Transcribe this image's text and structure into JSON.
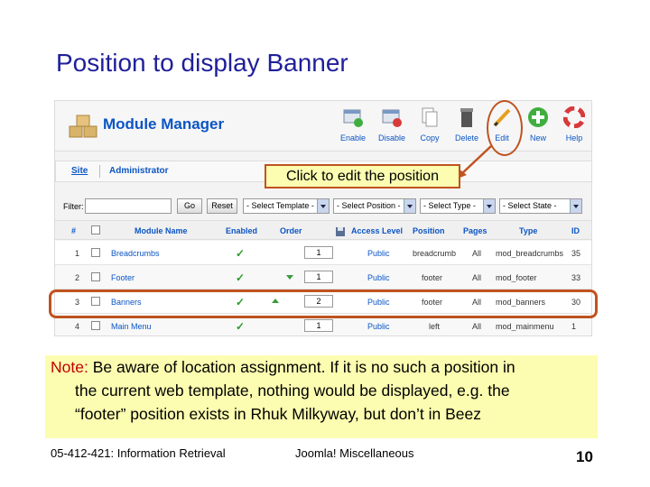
{
  "slide": {
    "title": "Position to display Banner",
    "callout": "Click to edit the position",
    "note_label": "Note:",
    "note_line1": "Be aware of location assignment. If it is no such a position in",
    "note_line2": "the current web template, nothing would be displayed, e.g. the",
    "note_line3": "“footer” position exists in Rhuk Milkyway, but don’t in Beez",
    "footer_left": "05-412-421: Information Retrieval",
    "footer_center": "Joomla! Miscellaneous",
    "page_number": "10"
  },
  "app": {
    "title": "Module Manager",
    "toolbar": {
      "enable": "Enable",
      "disable": "Disable",
      "copy": "Copy",
      "delete": "Delete",
      "edit": "Edit",
      "new": "New",
      "help": "Help"
    },
    "tabs": {
      "site": "Site",
      "administrator": "Administrator"
    },
    "filter": {
      "label": "Filter:",
      "go": "Go",
      "reset": "Reset",
      "template": "- Select Template -",
      "position": "- Select Position -",
      "type": "- Select Type -",
      "state": "- Select State -"
    },
    "columns": {
      "num": "#",
      "name": "Module Name",
      "enabled": "Enabled",
      "order": "Order",
      "access": "Access Level",
      "position": "Position",
      "pages": "Pages",
      "type": "Type",
      "id": "ID"
    },
    "rows": [
      {
        "num": "1",
        "name": "Breadcrumbs",
        "order": "1",
        "access": "Public",
        "position": "breadcrumb",
        "pages": "All",
        "type": "mod_breadcrumbs",
        "id": "35"
      },
      {
        "num": "2",
        "name": "Footer",
        "order": "1",
        "access": "Public",
        "position": "footer",
        "pages": "All",
        "type": "mod_footer",
        "id": "33"
      },
      {
        "num": "3",
        "name": "Banners",
        "order": "2",
        "access": "Public",
        "position": "footer",
        "pages": "All",
        "type": "mod_banners",
        "id": "30"
      },
      {
        "num": "4",
        "name": "Main Menu",
        "order": "1",
        "access": "Public",
        "position": "left",
        "pages": "All",
        "type": "mod_mainmenu",
        "id": "1"
      }
    ],
    "colors": {
      "link": "#0b55c4",
      "highlight": "#c0531f",
      "note_bg": "#fcfdb0",
      "title": "#1f1f9a"
    }
  }
}
